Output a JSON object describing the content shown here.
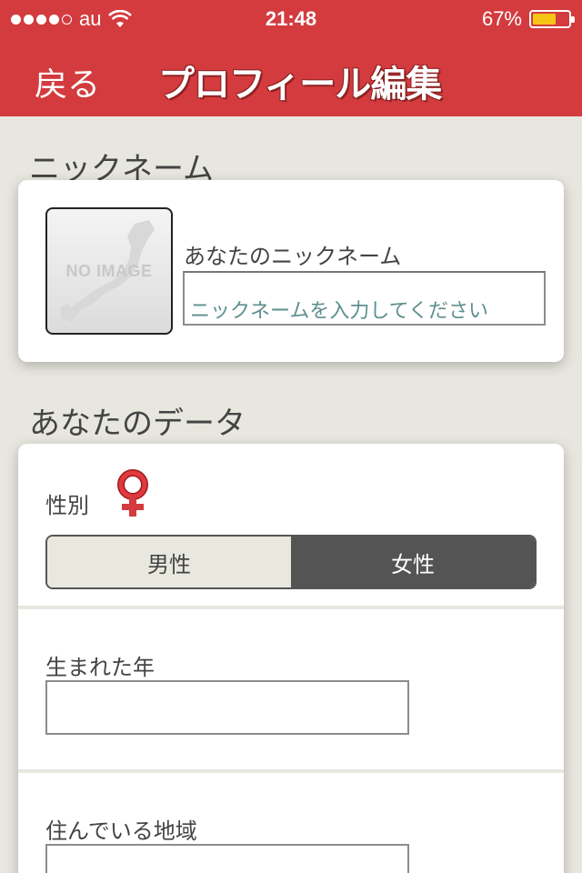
{
  "status_bar": {
    "carrier": "au",
    "time": "21:48",
    "battery_percent": "67%",
    "battery_level": 0.67,
    "signal_bars": 4,
    "signal_total": 5
  },
  "nav": {
    "back_label": "戻る",
    "title": "プロフィール編集"
  },
  "nickname_section": {
    "title": "ニックネーム",
    "avatar_text": "NO IMAGE",
    "field_label": "あなたのニックネーム",
    "field_value": "",
    "field_placeholder": "ニックネームを入力してください"
  },
  "data_section": {
    "title": "あなたのデータ",
    "gender_label": "性別",
    "gender_icon": "female-symbol-icon",
    "gender_options": [
      "男性",
      "女性"
    ],
    "gender_selected": "女性",
    "birth_year_label": "生まれた年",
    "birth_year_value": "",
    "region_label": "住んでいる地域",
    "region_value": ""
  },
  "colors": {
    "accent": "#d33b3e",
    "background": "#e8e7df",
    "segment_selected": "#545454",
    "battery": "#f5c518"
  }
}
